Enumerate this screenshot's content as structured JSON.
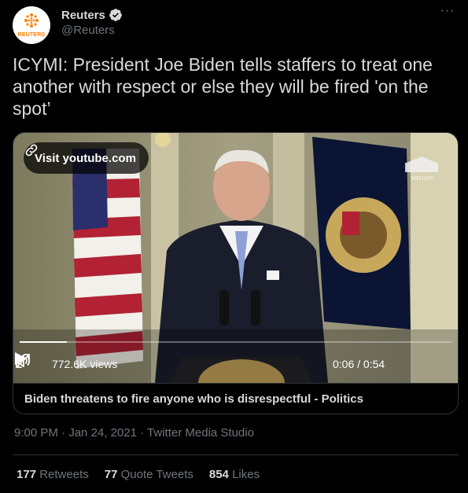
{
  "author": {
    "display_name": "Reuters",
    "handle": "@Reuters",
    "avatar_text": "REUTERS",
    "verified": true
  },
  "tweet": {
    "text": "ICYMI: President Joe Biden tells staffers to treat one another with respect or else they will be fired 'on the spot’"
  },
  "video_card": {
    "visit_label": "Visit youtube.com",
    "views": "772.6K views",
    "time": "0:06 / 0:54",
    "progress": 0.11,
    "watermark": "WH.GOV",
    "title": "Biden threatens to fire anyone who is disrespectful - Politics"
  },
  "meta": {
    "time": "9:00 PM",
    "date": "Jan 24, 2021",
    "source": "Twitter Media Studio"
  },
  "stats": [
    {
      "count": "177",
      "label": "Retweets"
    },
    {
      "count": "77",
      "label": "Quote Tweets"
    },
    {
      "count": "854",
      "label": "Likes"
    }
  ],
  "colors": {
    "background": "#000000",
    "text": "#d9d9d9",
    "muted": "#6e767d",
    "border": "#2f3336",
    "verified": "#d9d9d9",
    "brand": "#ff8000"
  },
  "icons": [
    "verified-icon",
    "more-icon",
    "link-icon",
    "play-icon",
    "volume-icon",
    "expand-icon"
  ]
}
